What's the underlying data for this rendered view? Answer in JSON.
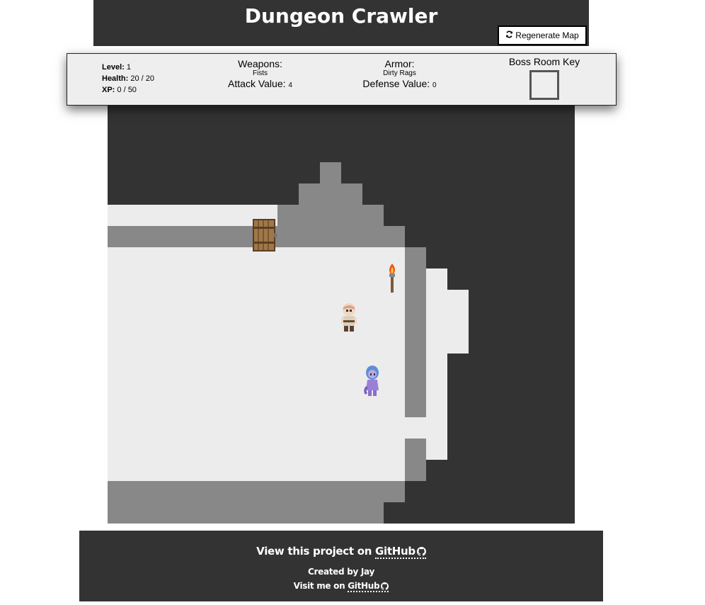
{
  "header": {
    "title": "Dungeon Crawler",
    "regenerate_label": "Regenerate Map",
    "regenerate_icon": "refresh-icon"
  },
  "stats": {
    "level_label": "Level:",
    "level_value": "1",
    "health_label": "Health:",
    "health_value": "20 / 20",
    "xp_label": "XP:",
    "xp_value": "0 / 50",
    "weapons_label": "Weapons:",
    "weapon_name": "Fists",
    "attack_label": "Attack Value:",
    "attack_value": "4",
    "armor_label": "Armor:",
    "armor_name": "Dirty Rags",
    "defense_label": "Defense Value:",
    "defense_value": "0",
    "key_label": "Boss Room Key"
  },
  "map": {
    "sprites": [
      "door-sprite",
      "torch-sprite",
      "player-sprite",
      "enemy-sprite"
    ],
    "colors": {
      "wall": "#333333",
      "floor_lit": "#ececec",
      "floor_dim": "#888888"
    }
  },
  "footer": {
    "view_text": "View this project on",
    "github_label": "GitHub",
    "created_by": "Created by Jay",
    "visit_text": "Visit me on",
    "visit_link": "GitHub",
    "github_icon": "github-icon"
  }
}
